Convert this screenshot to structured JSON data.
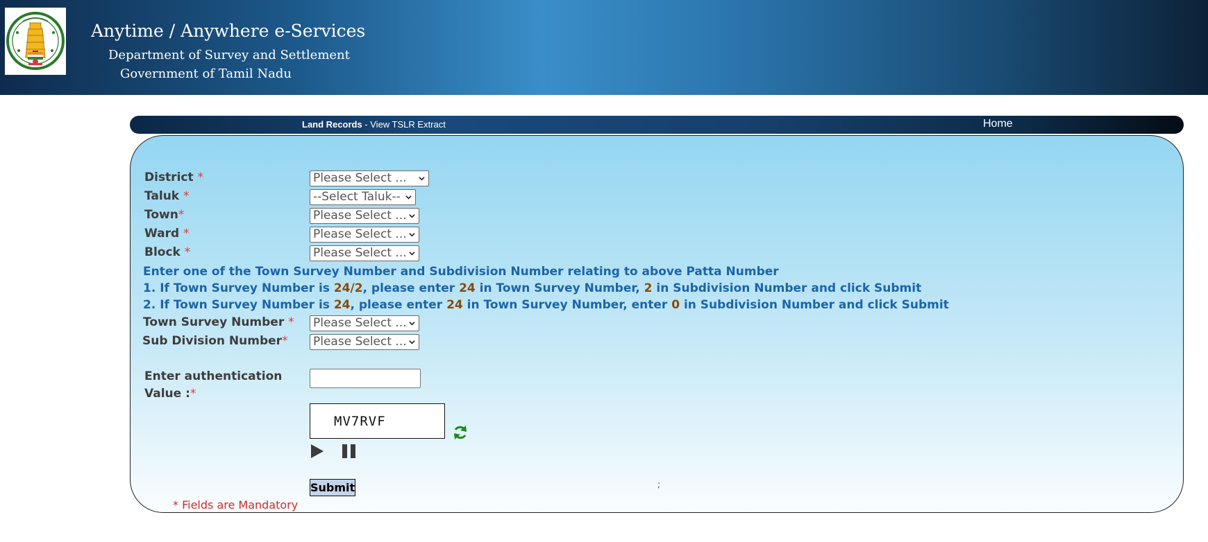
{
  "header": {
    "title": "Anytime / Anywhere e-Services",
    "department": "Department of Survey and Settlement",
    "government": "Government of Tamil Nadu",
    "emblem_icon": "tamil-nadu-emblem-icon"
  },
  "nav": {
    "title_bold": "Land Records",
    "title_rest": " - View TSLR Extract",
    "home": "Home"
  },
  "form": {
    "district": {
      "label": "District ",
      "required": "*",
      "value": "Please Select ..."
    },
    "taluk": {
      "label": "Taluk ",
      "required": "*",
      "value": "--Select Taluk--"
    },
    "town": {
      "label": "Town",
      "required": "*",
      "value": "Please Select ..."
    },
    "ward": {
      "label": "Ward ",
      "required": "*",
      "value": "Please Select ..."
    },
    "block": {
      "label": "Block ",
      "required": "*",
      "value": "Please Select ..."
    },
    "instructions": {
      "line0": "Enter one of the Town Survey Number and Subdivision Number relating to above Patta Number",
      "line1": {
        "a": "1. If Town Survey Number is ",
        "b": "24/2",
        "c": ", please enter ",
        "d": "24",
        "e": " in Town Survey Number, ",
        "f": "2",
        "g": " in Subdivision Number and click Submit"
      },
      "line2": {
        "a": "2. If Town Survey Number is ",
        "b": "24",
        "c": ", please enter ",
        "d": "24",
        "e": " in Town Survey Number, enter ",
        "f": "0",
        "g": " in Subdivision Number and click Submit"
      }
    },
    "town_survey_number": {
      "label": "Town Survey Number ",
      "required": "*",
      "value": "Please Select ..."
    },
    "sub_division_number": {
      "label": "Sub Division Number",
      "required": "*",
      "value": "Please Select ..."
    },
    "auth": {
      "label_line1": "Enter authentication",
      "label_line2": "Value :",
      "required": "*",
      "value": ""
    },
    "captcha_text": "MV7RVF",
    "refresh_icon": "refresh-icon",
    "play_icon": "play-icon",
    "pause_icon": "pause-icon",
    "submit_label": "Submit",
    "mandatory_note": "* Fields are Mandatory",
    "stray_text": ";"
  },
  "colors": {
    "label": "#3d3d3d",
    "required": "#e03a3a",
    "info": "#1c64a8",
    "highlight": "#8a4a0a",
    "refresh": "#1a8a1a"
  }
}
